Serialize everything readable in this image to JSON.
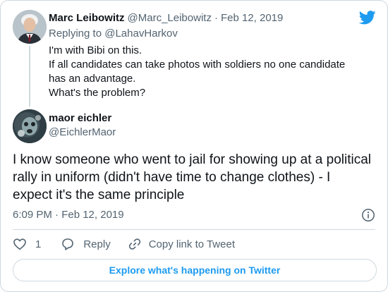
{
  "parent_tweet": {
    "author_name": "Marc Leibowitz",
    "author_handle": "@Marc_Leibowitz",
    "separator": "·",
    "date": "Feb 12, 2019",
    "replying_prefix": "Replying to",
    "replying_to": "@LahavHarkov",
    "lines": [
      "I'm with Bibi on this.",
      "If all candidates can take photos with soldiers no one candidate has an advantage.",
      "What's the problem?"
    ]
  },
  "main_tweet": {
    "author_name": "maor eichler",
    "author_handle": "@EichlerMaor",
    "text": "I know someone who went to jail for showing up at a political rally in uniform (didn't have time to change clothes) - I expect it's the same principle",
    "timestamp": "6:09 PM · Feb 12, 2019"
  },
  "actions": {
    "like_count": "1",
    "reply_label": "Reply",
    "copy_link_label": "Copy link to Tweet"
  },
  "explore_label": "Explore what's happening on Twitter",
  "colors": {
    "brand": "#1d9bf0",
    "text": "#0f1419",
    "secondary": "#536471",
    "border": "#cfd9de"
  },
  "icons": [
    "twitter-bird-icon",
    "info-icon",
    "heart-icon",
    "reply-icon",
    "link-icon"
  ]
}
